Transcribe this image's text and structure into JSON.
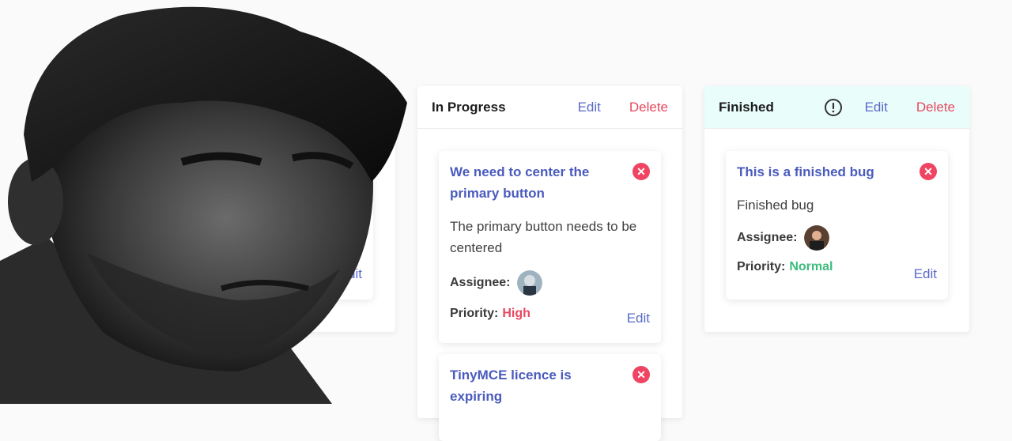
{
  "columns": [
    {
      "title": "",
      "card_edit": "Edit"
    },
    {
      "title": "In Progress",
      "edit": "Edit",
      "delete": "Delete",
      "cards": [
        {
          "title": "We need to center the primary button",
          "description": "The primary button needs to be centered",
          "assignee_label": "Assignee:",
          "priority_label": "Priority:",
          "priority": "High",
          "edit": "Edit"
        },
        {
          "title": "TinyMCE licence is expiring"
        }
      ]
    },
    {
      "title": "Finished",
      "edit": "Edit",
      "delete": "Delete",
      "cards": [
        {
          "title": "This is a finished bug",
          "description": "Finished bug",
          "assignee_label": "Assignee:",
          "priority_label": "Priority:",
          "priority": "Normal",
          "edit": "Edit"
        }
      ]
    }
  ],
  "icons": {
    "close": "close-circle-icon",
    "warning": "exclamation-circle-icon"
  },
  "colors": {
    "accent": "#5a6ac8",
    "danger": "#e8485f",
    "success": "#3dbb7e",
    "finished_header": "#e9fdfb"
  }
}
